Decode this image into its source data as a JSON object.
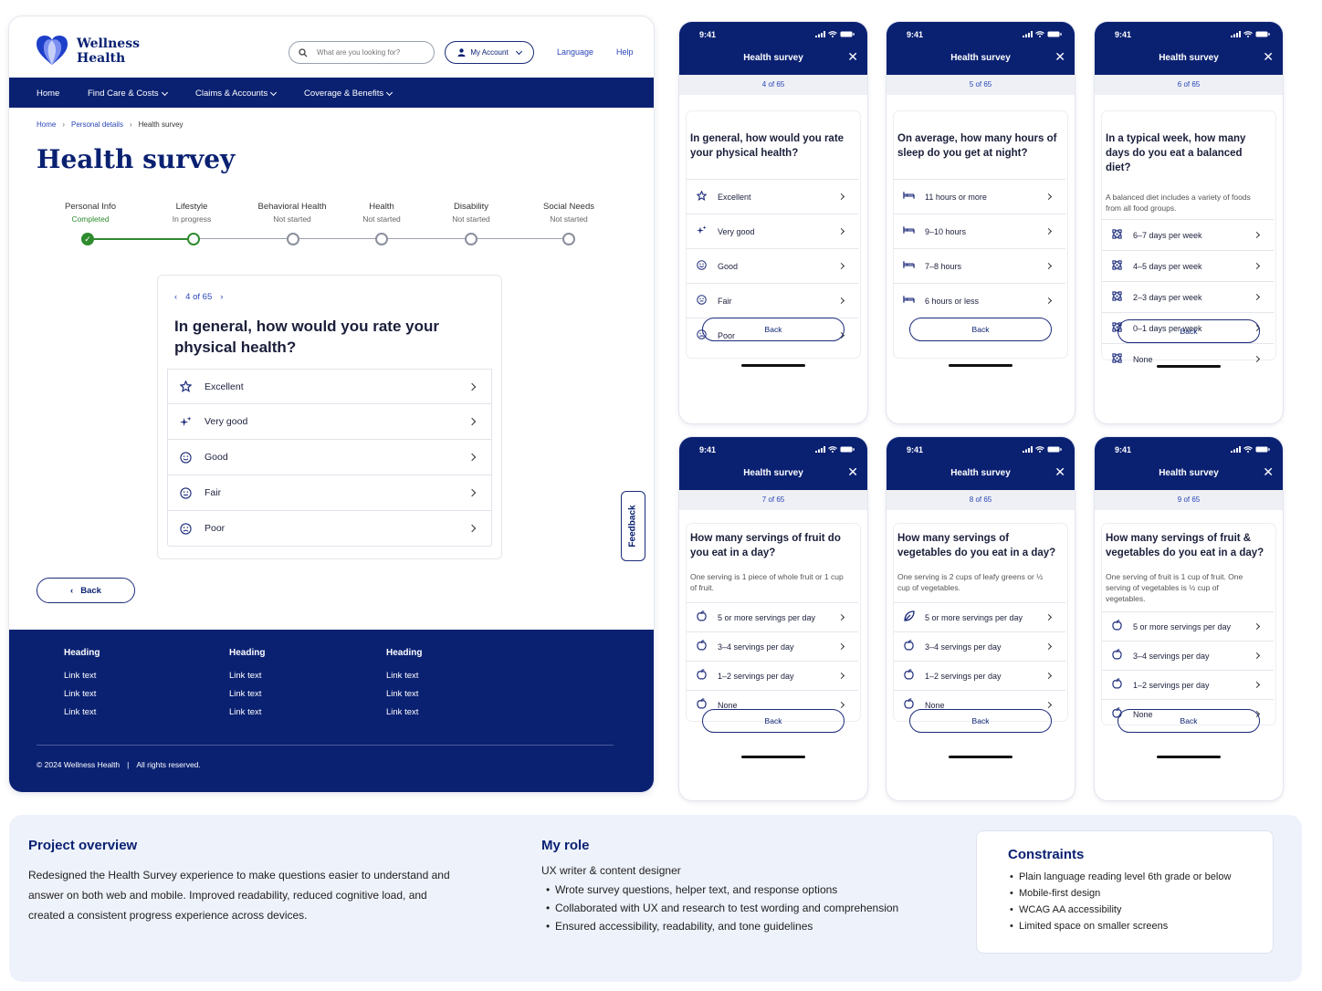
{
  "desktop": {
    "brand": {
      "line1": "Wellness",
      "line2": "Health"
    },
    "search": {
      "placeholder": "What are you looking for?"
    },
    "account_label": "My Account",
    "language_label": "Language",
    "help_label": "Help",
    "nav": [
      "Home",
      "Find Care & Costs",
      "Claims & Accounts",
      "Coverage & Benefits"
    ],
    "breadcrumb": [
      "Home",
      "Personal details",
      "Health survey"
    ],
    "page_title": "Health survey",
    "steps": [
      {
        "title": "Personal Info",
        "status": "Completed"
      },
      {
        "title": "Lifestyle",
        "status": "In progress"
      },
      {
        "title": "Behavioral Health",
        "status": "Not started"
      },
      {
        "title": "Health",
        "status": "Not started"
      },
      {
        "title": "Disability",
        "status": "Not started"
      },
      {
        "title": "Social Needs",
        "status": "Not started"
      }
    ],
    "card": {
      "progress": "4 of 65",
      "question": "In general, how would you rate your physical health?",
      "options": [
        {
          "label": "Excellent",
          "icon": "star-icon"
        },
        {
          "label": "Very good",
          "icon": "sparkle-icon"
        },
        {
          "label": "Good",
          "icon": "smile-icon"
        },
        {
          "label": "Fair",
          "icon": "neutral-face-icon"
        },
        {
          "label": "Poor",
          "icon": "sad-face-icon"
        }
      ]
    },
    "back_label": "Back",
    "feedback_label": "Feedback",
    "footer": {
      "columns": [
        {
          "heading": "Heading",
          "links": [
            "Link text",
            "Link text",
            "Link text"
          ]
        },
        {
          "heading": "Heading",
          "links": [
            "Link text",
            "Link text",
            "Link text"
          ]
        },
        {
          "heading": "Heading",
          "links": [
            "Link text",
            "Link text",
            "Link text"
          ]
        }
      ],
      "copyright": "© 2024 Wellness Health",
      "rights": "All rights reserved."
    }
  },
  "phones": [
    {
      "time": "9:41",
      "title": "Health survey",
      "progress": "4 of 65",
      "question": "In general, how would you rate your physical health?",
      "helper": "",
      "options": [
        "Excellent",
        "Very good",
        "Good",
        "Fair",
        "Poor"
      ],
      "back": "Back"
    },
    {
      "time": "9:41",
      "title": "Health survey",
      "progress": "5 of 65",
      "question": "On average, how many hours of sleep do you get at night?",
      "helper": "",
      "options": [
        "11 hours or more",
        "9–10 hours",
        "7–8 hours",
        "6 hours or less"
      ],
      "back": "Back"
    },
    {
      "time": "9:41",
      "title": "Health survey",
      "progress": "6 of 65",
      "question": "In a typical week, how many days do you eat a balanced diet?",
      "helper": "A balanced diet includes a variety of foods from all food groups.",
      "options": [
        "6–7 days per week",
        "4–5 days per week",
        "2–3 days per week",
        "0–1 days per week",
        "None"
      ],
      "back": "Back"
    },
    {
      "time": "9:41",
      "title": "Health survey",
      "progress": "7 of 65",
      "question": "How many servings of fruit do you eat in a day?",
      "helper": "One serving is 1 piece of whole fruit or 1 cup of fruit.",
      "options": [
        "5 or more servings per day",
        "3–4 servings per day",
        "1–2 servings per day",
        "None"
      ],
      "back": "Back"
    },
    {
      "time": "9:41",
      "title": "Health survey",
      "progress": "8 of 65",
      "question": "How many servings of vegetables do you eat in a day?",
      "helper": "One serving is 2 cups of leafy greens or ½ cup of vegetables.",
      "options": [
        "5 or more servings per day",
        "3–4 servings per day",
        "1–2 servings per day",
        "None"
      ],
      "back": "Back"
    },
    {
      "time": "9:41",
      "title": "Health survey",
      "progress": "9 of 65",
      "question": "How many servings of fruit & vegetables do you eat in a day?",
      "helper": "One serving of fruit is 1 cup of fruit. One serving of vegetables is ½ cup of vegetables.",
      "options": [
        "5 or more servings per day",
        "3–4 servings per day",
        "1–2 servings per day",
        "None"
      ],
      "back": "Back"
    }
  ],
  "overview": {
    "title": "Project overview",
    "text": "Redesigned the Health Survey experience to make questions easier to understand and answer on both web and mobile. Improved readability, reduced cognitive load, and created a consistent progress experience across devices."
  },
  "role": {
    "title": "My role",
    "subtitle": "UX writer & content designer",
    "bullets": [
      "Wrote survey questions, helper text, and response options",
      "Collaborated with UX and research to test wording and comprehension",
      "Ensured accessibility, readability, and tone guidelines"
    ]
  },
  "constraints": {
    "title": "Constraints",
    "bullets": [
      "Plain language reading level 6th grade or below",
      "Mobile-first design",
      "WCAG AA accessibility",
      "Limited space on smaller screens"
    ]
  },
  "colors": {
    "brand_navy": "#0a2172",
    "success_green": "#2e8b2e",
    "link_blue": "#2a45b8"
  }
}
